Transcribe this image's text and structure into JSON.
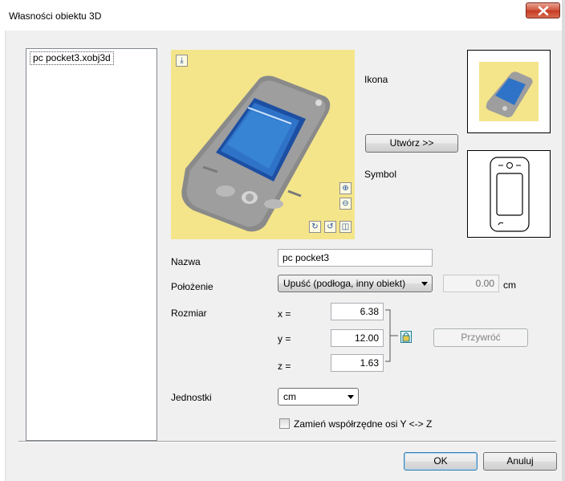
{
  "window": {
    "title": "Własności obiektu 3D"
  },
  "file_list": {
    "items": [
      "pc pocket3.xobj3d"
    ]
  },
  "preview": {
    "tools": [
      "reset-view-icon",
      "zoom-in-icon",
      "zoom-out-icon",
      "rotate-left-icon",
      "rotate-right-icon",
      "fit-view-icon"
    ]
  },
  "labels": {
    "icon": "Ikona",
    "symbol": "Symbol",
    "name": "Nazwa",
    "position": "Położenie",
    "size": "Rozmiar",
    "units": "Jednostki"
  },
  "buttons": {
    "create": "Utwórz >>",
    "restore": "Przywróć",
    "ok": "OK",
    "cancel": "Anuluj"
  },
  "fields": {
    "name": "pc pocket3",
    "position_mode": "Upuść (podłoga, inny obiekt)",
    "position_value": "0.00",
    "position_unit": "cm",
    "x_label": "x =",
    "y_label": "y =",
    "z_label": "z =",
    "x": "6.38",
    "y": "12.00",
    "z": "1.63",
    "units": "cm"
  },
  "checkbox": {
    "swap_axes_label": "Zamień współrzędne osi Y <-> Z",
    "checked": false
  },
  "colors": {
    "preview_bg": "#f4e58a",
    "close_button": "#c9462d"
  }
}
